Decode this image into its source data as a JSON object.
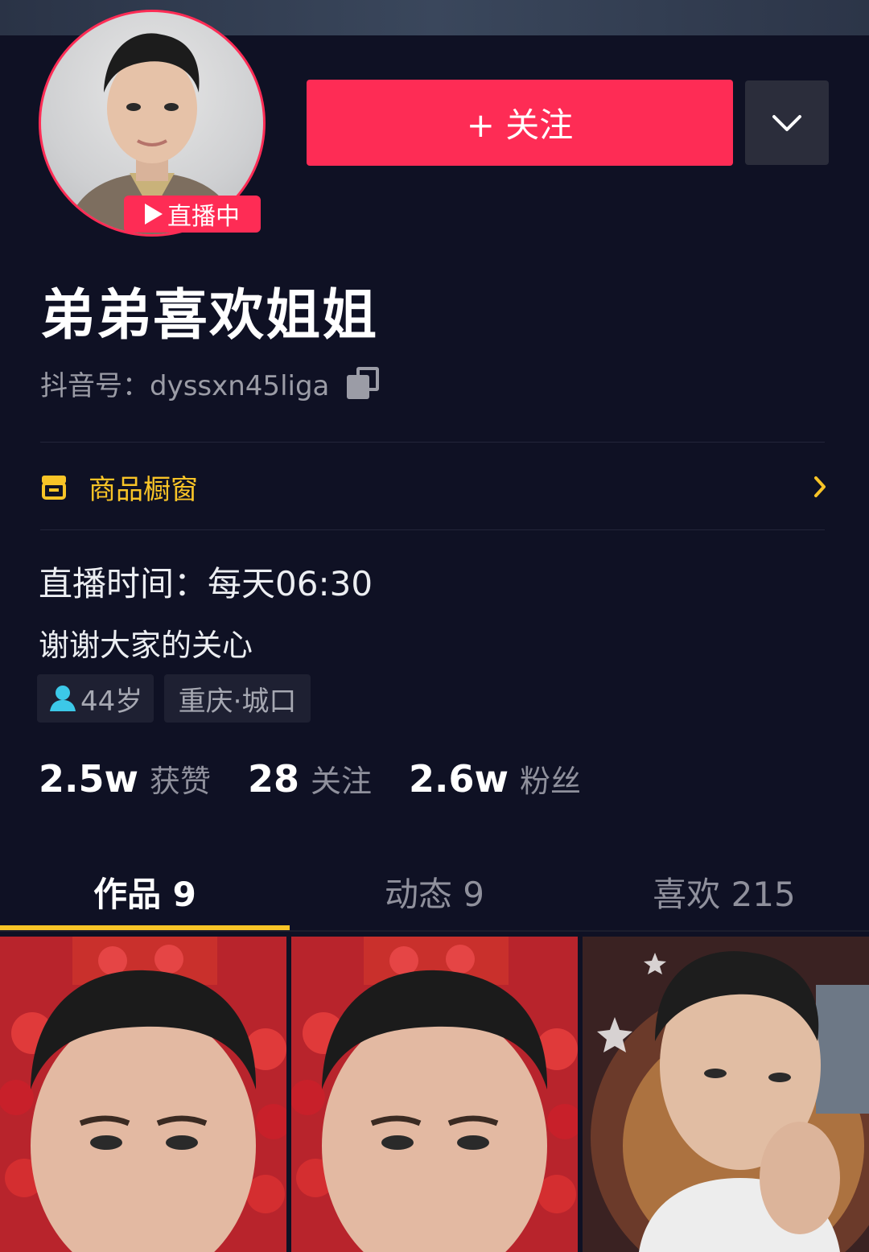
{
  "colors": {
    "background": "#0f1124",
    "accent_red": "#fe2c55",
    "accent_yellow": "#f8c427",
    "muted_text": "#8f909c"
  },
  "profile": {
    "live_badge": "直播中",
    "name": "弟弟喜欢姐姐",
    "douyin_id": "抖音号：dyssxn45liga",
    "copy_icon": "copy-icon"
  },
  "actions": {
    "follow_label": "+ 关注",
    "dropdown_icon": "chevron-down-icon"
  },
  "shop": {
    "icon": "shop-icon",
    "label": "商品橱窗",
    "chevron_icon": "chevron-right-icon"
  },
  "bio": {
    "line1": "直播时间：每天06:30",
    "line2": "谢谢大家的关心"
  },
  "tags": {
    "age": "44岁",
    "location": "重庆·城口"
  },
  "stats": [
    {
      "value": "2.5w",
      "label": "获赞"
    },
    {
      "value": "28",
      "label": "关注"
    },
    {
      "value": "2.6w",
      "label": "粉丝"
    }
  ],
  "tabs": [
    {
      "label": "作品 9",
      "active": true
    },
    {
      "label": "动态 9",
      "active": false
    },
    {
      "label": "喜欢 215",
      "active": false
    }
  ]
}
